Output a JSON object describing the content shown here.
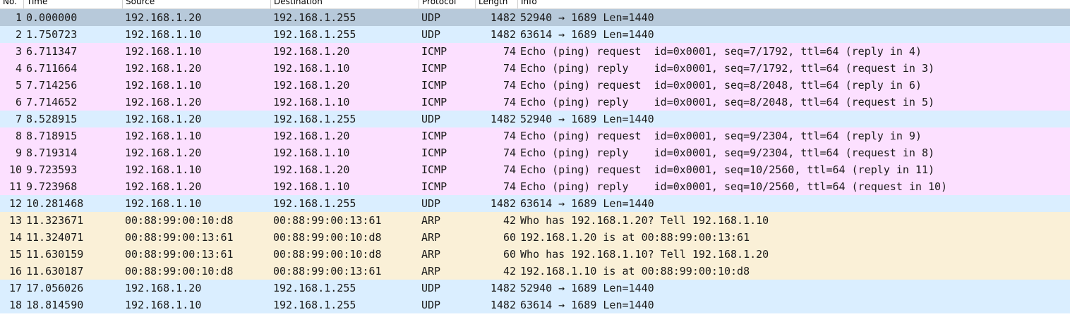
{
  "colors": {
    "udp": "#daeeff",
    "icmp": "#fce0ff",
    "arp": "#faf0d7",
    "selected": "#b7c9da"
  },
  "columns": [
    {
      "key": "no",
      "label": "No."
    },
    {
      "key": "time",
      "label": "Time"
    },
    {
      "key": "src",
      "label": "Source"
    },
    {
      "key": "dst",
      "label": "Destination"
    },
    {
      "key": "proto",
      "label": "Protocol"
    },
    {
      "key": "len",
      "label": "Length"
    },
    {
      "key": "info",
      "label": "Info"
    }
  ],
  "packets": [
    {
      "no": "1",
      "time": "0.000000",
      "src": "192.168.1.20",
      "dst": "192.168.1.255",
      "proto": "UDP",
      "len": "1482",
      "info": "52940 → 1689 Len=1440",
      "type": "udp",
      "selected": true
    },
    {
      "no": "2",
      "time": "1.750723",
      "src": "192.168.1.10",
      "dst": "192.168.1.255",
      "proto": "UDP",
      "len": "1482",
      "info": "63614 → 1689 Len=1440",
      "type": "udp"
    },
    {
      "no": "3",
      "time": "6.711347",
      "src": "192.168.1.10",
      "dst": "192.168.1.20",
      "proto": "ICMP",
      "len": "74",
      "info": "Echo (ping) request  id=0x0001, seq=7/1792, ttl=64 (reply in 4)",
      "type": "icmp"
    },
    {
      "no": "4",
      "time": "6.711664",
      "src": "192.168.1.20",
      "dst": "192.168.1.10",
      "proto": "ICMP",
      "len": "74",
      "info": "Echo (ping) reply    id=0x0001, seq=7/1792, ttl=64 (request in 3)",
      "type": "icmp"
    },
    {
      "no": "5",
      "time": "7.714256",
      "src": "192.168.1.10",
      "dst": "192.168.1.20",
      "proto": "ICMP",
      "len": "74",
      "info": "Echo (ping) request  id=0x0001, seq=8/2048, ttl=64 (reply in 6)",
      "type": "icmp"
    },
    {
      "no": "6",
      "time": "7.714652",
      "src": "192.168.1.20",
      "dst": "192.168.1.10",
      "proto": "ICMP",
      "len": "74",
      "info": "Echo (ping) reply    id=0x0001, seq=8/2048, ttl=64 (request in 5)",
      "type": "icmp"
    },
    {
      "no": "7",
      "time": "8.528915",
      "src": "192.168.1.20",
      "dst": "192.168.1.255",
      "proto": "UDP",
      "len": "1482",
      "info": "52940 → 1689 Len=1440",
      "type": "udp"
    },
    {
      "no": "8",
      "time": "8.718915",
      "src": "192.168.1.10",
      "dst": "192.168.1.20",
      "proto": "ICMP",
      "len": "74",
      "info": "Echo (ping) request  id=0x0001, seq=9/2304, ttl=64 (reply in 9)",
      "type": "icmp"
    },
    {
      "no": "9",
      "time": "8.719314",
      "src": "192.168.1.20",
      "dst": "192.168.1.10",
      "proto": "ICMP",
      "len": "74",
      "info": "Echo (ping) reply    id=0x0001, seq=9/2304, ttl=64 (request in 8)",
      "type": "icmp"
    },
    {
      "no": "10",
      "time": "9.723593",
      "src": "192.168.1.10",
      "dst": "192.168.1.20",
      "proto": "ICMP",
      "len": "74",
      "info": "Echo (ping) request  id=0x0001, seq=10/2560, ttl=64 (reply in 11)",
      "type": "icmp"
    },
    {
      "no": "11",
      "time": "9.723968",
      "src": "192.168.1.20",
      "dst": "192.168.1.10",
      "proto": "ICMP",
      "len": "74",
      "info": "Echo (ping) reply    id=0x0001, seq=10/2560, ttl=64 (request in 10)",
      "type": "icmp"
    },
    {
      "no": "12",
      "time": "10.281468",
      "src": "192.168.1.10",
      "dst": "192.168.1.255",
      "proto": "UDP",
      "len": "1482",
      "info": "63614 → 1689 Len=1440",
      "type": "udp"
    },
    {
      "no": "13",
      "time": "11.323671",
      "src": "00:88:99:00:10:d8",
      "dst": "00:88:99:00:13:61",
      "proto": "ARP",
      "len": "42",
      "info": "Who has 192.168.1.20? Tell 192.168.1.10",
      "type": "arp"
    },
    {
      "no": "14",
      "time": "11.324071",
      "src": "00:88:99:00:13:61",
      "dst": "00:88:99:00:10:d8",
      "proto": "ARP",
      "len": "60",
      "info": "192.168.1.20 is at 00:88:99:00:13:61",
      "type": "arp"
    },
    {
      "no": "15",
      "time": "11.630159",
      "src": "00:88:99:00:13:61",
      "dst": "00:88:99:00:10:d8",
      "proto": "ARP",
      "len": "60",
      "info": "Who has 192.168.1.10? Tell 192.168.1.20",
      "type": "arp"
    },
    {
      "no": "16",
      "time": "11.630187",
      "src": "00:88:99:00:10:d8",
      "dst": "00:88:99:00:13:61",
      "proto": "ARP",
      "len": "42",
      "info": "192.168.1.10 is at 00:88:99:00:10:d8",
      "type": "arp"
    },
    {
      "no": "17",
      "time": "17.056026",
      "src": "192.168.1.20",
      "dst": "192.168.1.255",
      "proto": "UDP",
      "len": "1482",
      "info": "52940 → 1689 Len=1440",
      "type": "udp"
    },
    {
      "no": "18",
      "time": "18.814590",
      "src": "192.168.1.10",
      "dst": "192.168.1.255",
      "proto": "UDP",
      "len": "1482",
      "info": "63614 → 1689 Len=1440",
      "type": "udp"
    }
  ]
}
